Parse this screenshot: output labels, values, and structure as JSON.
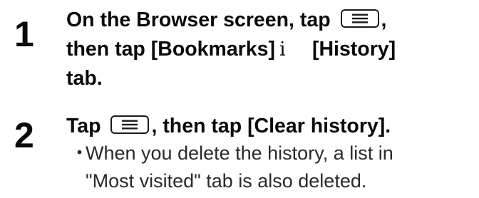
{
  "steps": [
    {
      "number": "1",
      "line1_before": "On the Browser screen, tap ",
      "line1_after": ",",
      "line2_first": "then tap [Bookmarks]",
      "line2_sep": "i",
      "line2_second": "[History]",
      "line3": "tab.",
      "icon": "menu-icon"
    },
    {
      "number": "2",
      "line1_before": "Tap ",
      "line1_after": ", then tap [Clear history].",
      "icon": "menu-icon",
      "note": {
        "bullet": "・",
        "line1": "When you delete the history, a list in",
        "line2": "\"Most visited\" tab is also deleted."
      }
    }
  ]
}
